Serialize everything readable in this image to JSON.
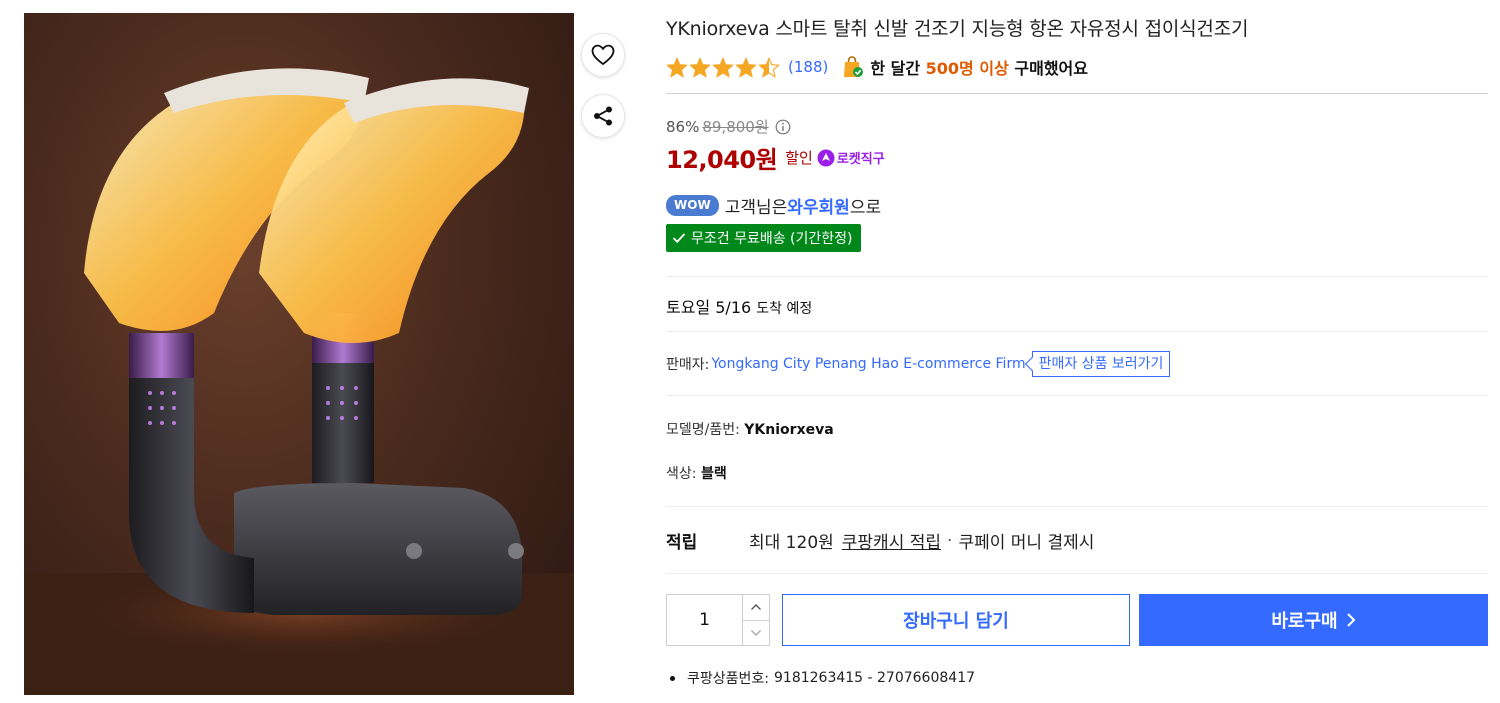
{
  "product": {
    "title": "YKniorxeva 스마트 탈취 신발 건조기 지능형 항온 자유정시 접이식건조기",
    "image_alt": "스마트 신발 건조기 제품 이미지"
  },
  "rating": {
    "stars": 4.5,
    "review_count": "(188)"
  },
  "sales": {
    "prefix": "한 달간",
    "highlight": "500명 이상",
    "suffix": "구매했어요"
  },
  "price": {
    "discount_rate": "86%",
    "original": "89,800원",
    "sale": "12,040원",
    "sale_label": "할인",
    "rocket_label": "로켓직구"
  },
  "wow": {
    "badge": "WOW",
    "text_before": "고객님은",
    "member": "와우회원",
    "text_after": "으로"
  },
  "shipping": {
    "free_label": "무조건 무료배송 (기간한정)",
    "arrival_day": "토요일 5/16",
    "arrival_suffix": "도착 예정"
  },
  "seller": {
    "label": "판매자:",
    "name": "Yongkang City Penang Hao E-commerce Firm",
    "link": "판매자 상품 보러가기"
  },
  "specs": {
    "model_label": "모델명/품번:",
    "model_value": "YKniorxeva",
    "color_label": "색상:",
    "color_value": "블랙"
  },
  "reward": {
    "label": "적립",
    "amount": "최대 120원",
    "link": "쿠팡캐시 적립",
    "sep": "·",
    "condition": "쿠페이 머니 결제시"
  },
  "purchase": {
    "quantity": "1",
    "cart_label": "장바구니 담기",
    "buy_label": "바로구매"
  },
  "product_number": {
    "label": "쿠팡상품번호:",
    "value": "9181263415 - 27076608417"
  },
  "colors": {
    "accent": "#346aff",
    "price": "#ae0000",
    "free_ship": "#00891a",
    "star": "#f5a623",
    "sales_highlight": "#e05a00"
  },
  "icons": {
    "like": "heart-icon",
    "share": "share-icon",
    "bag": "shopping-bag-check-icon",
    "info": "info-circle-icon",
    "rocket": "rocket-direct-icon",
    "check": "check-icon",
    "buy_arrow": "chevron-right-icon"
  }
}
